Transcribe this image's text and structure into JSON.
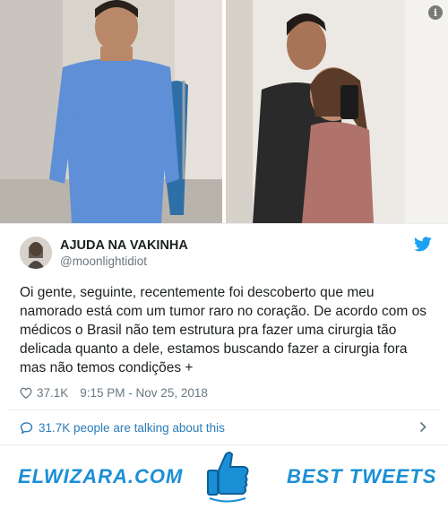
{
  "tweet": {
    "author_name": "AJUDA NA VAKINHA",
    "author_handle": "@moonlightidiot",
    "text": "Oi gente, seguinte, recentemente foi descoberto que meu namorado está com um tumor raro no coração. De acordo com os médicos o Brasil não tem estrutura pra fazer uma cirurgia tão delicada quanto a dele, estamos buscando fazer a cirurgia fora mas não temos condições +",
    "likes": "37.1K",
    "timestamp": "9:15 PM - Nov 25, 2018",
    "talking": "31.7K people are talking about this"
  },
  "icons": {
    "info": "info-icon",
    "brand": "twitter-bird-icon",
    "like": "heart-icon",
    "conversation": "speech-bubble-icon",
    "chevron": "chevron-right-icon",
    "thumb": "thumbs-up-icon"
  },
  "colors": {
    "twitter_blue": "#1da1f2",
    "link_blue": "#2b7bb9",
    "meta_gray": "#697882",
    "footer_blue": "#1a8fd6"
  },
  "footer": {
    "left_label": "ELWIZARA.COM",
    "right_label": "BEST TWEETS"
  }
}
